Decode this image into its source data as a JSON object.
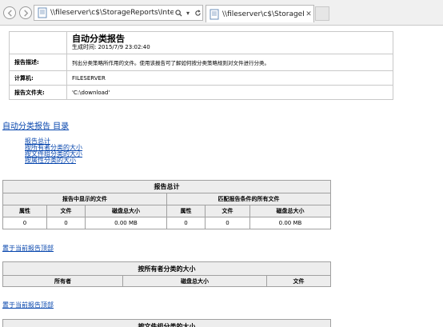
{
  "browser": {
    "address_url": "\\\\fileserver\\c$\\StorageReports\\Interact",
    "tab_title": "\\\\fileserver\\c$\\StorageR..."
  },
  "report_header": {
    "title": "自动分类报告",
    "generated": "生成时间: 2015/7/9 23:02:40",
    "rows": [
      {
        "label": "报告描述:",
        "value": "列出分类策略所作用的文件。使用该报告可了解如何按分类策略规则对文件进行分类。"
      },
      {
        "label": "计算机:",
        "value": "FILESERVER"
      },
      {
        "label": "报告文件夹:",
        "value": "'C:\\download'"
      }
    ]
  },
  "toc": {
    "title": "自动分类报告  目录",
    "items": [
      "报告总计",
      "按所有者分类的大小",
      "按文件组分类的大小",
      "按属性分类的大小"
    ]
  },
  "summary": {
    "title": "报告总计",
    "group_left": "报告中显示的文件",
    "group_right": "匹配报告条件的所有文件",
    "columns": [
      "属性",
      "文件",
      "磁盘总大小",
      "属性",
      "文件",
      "磁盘总大小"
    ],
    "row": [
      "0",
      "0",
      "0.00 MB",
      "0",
      "0",
      "0.00 MB"
    ]
  },
  "back_link": "置于当前报告顶部",
  "by_owner": {
    "title": "按所有者分类的大小",
    "columns": [
      "所有者",
      "磁盘总大小",
      "文件"
    ]
  },
  "by_filegroup": {
    "title": "按文件组分类的大小"
  }
}
